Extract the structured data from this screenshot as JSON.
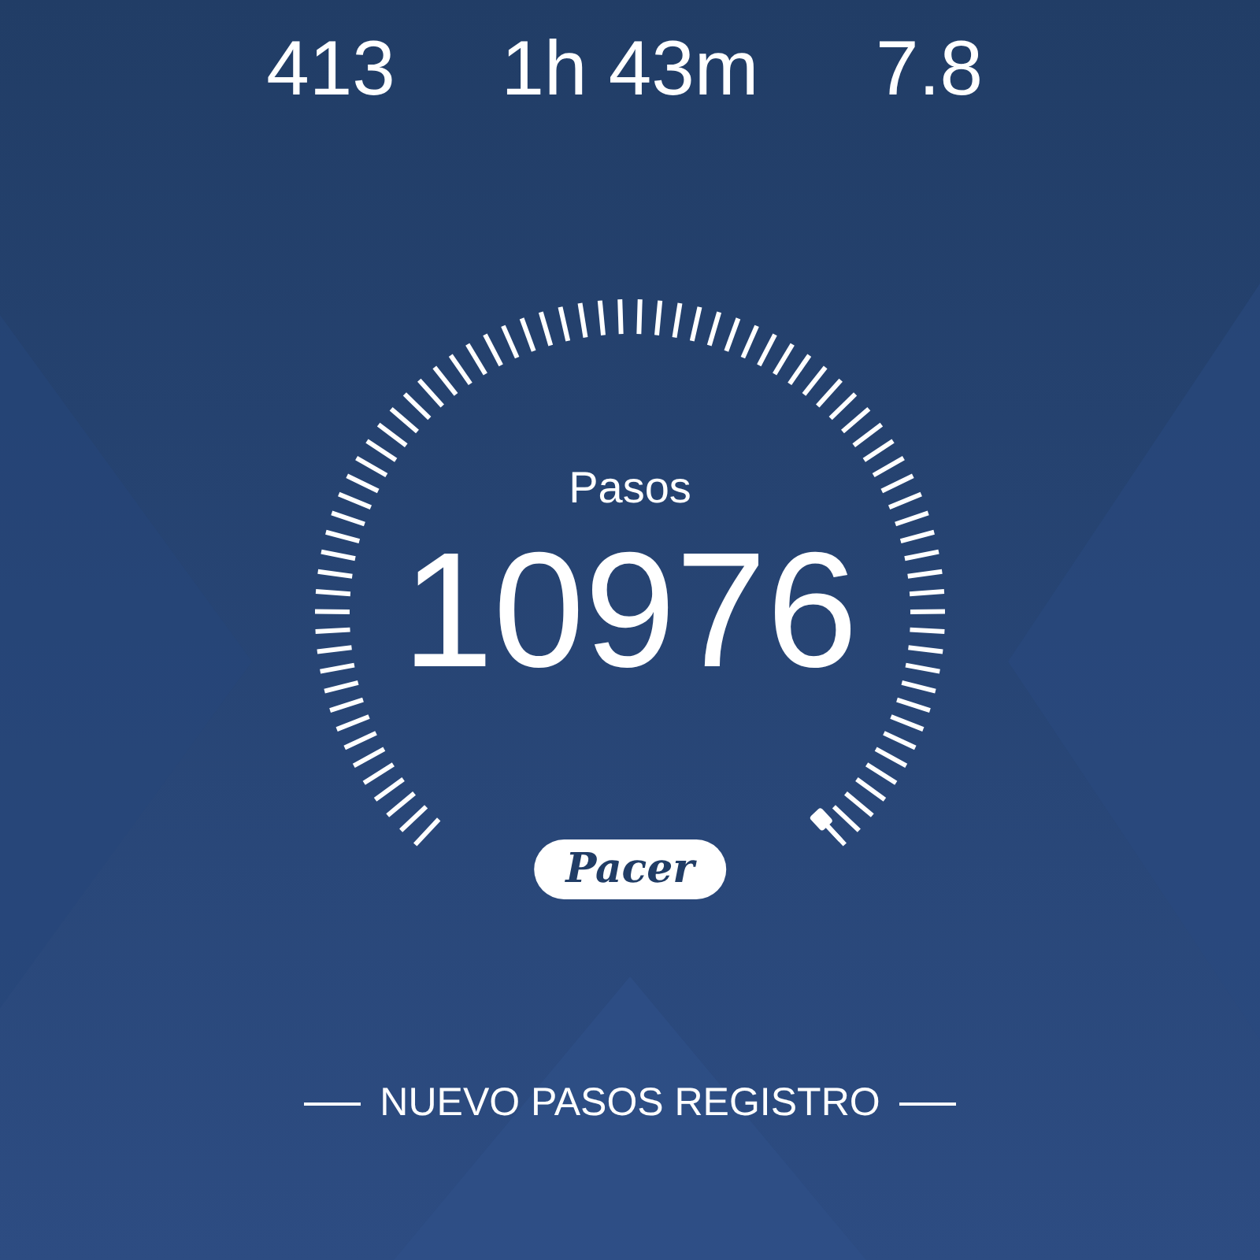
{
  "stats": [
    {
      "value": "413"
    },
    {
      "value": "1h 43m"
    },
    {
      "value": "7.8"
    }
  ],
  "gauge": {
    "label": "Pasos",
    "value": "10976"
  },
  "brand": "Pacer",
  "record_banner": "NUEVO PASOS REGISTRO"
}
